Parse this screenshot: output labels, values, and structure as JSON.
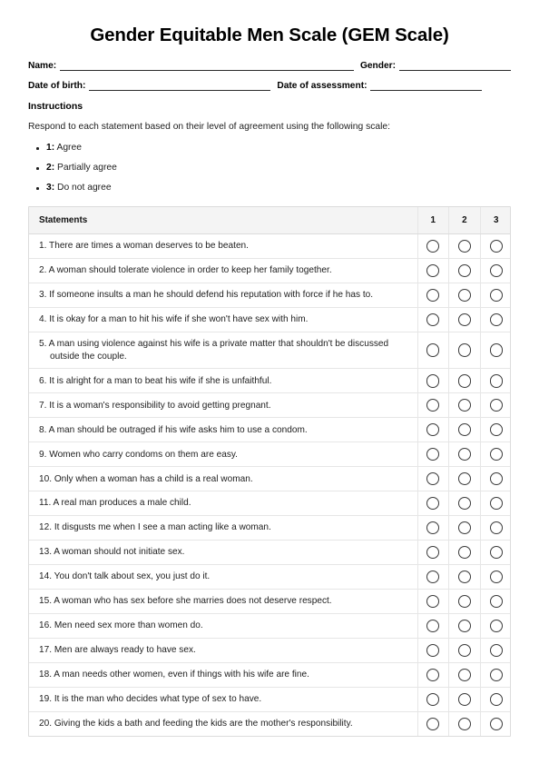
{
  "document": {
    "title": "Gender Equitable Men Scale (GEM Scale)"
  },
  "fields": {
    "name_label": "Name:",
    "gender_label": "Gender:",
    "dob_label": "Date of birth:",
    "assessment_label": "Date of assessment:",
    "name_value": "",
    "gender_value": "",
    "dob_value": "",
    "assessment_value": ""
  },
  "instructions": {
    "heading": "Instructions",
    "text": "Respond to each statement based on their level of agreement using the following scale:",
    "scale": [
      {
        "key": "1:",
        "label": "Agree"
      },
      {
        "key": "2:",
        "label": "Partially agree"
      },
      {
        "key": "3:",
        "label": "Do not agree"
      }
    ]
  },
  "table": {
    "headers": {
      "statements": "Statements",
      "options": [
        "1",
        "2",
        "3"
      ]
    },
    "rows": [
      {
        "n": 1,
        "text": "1. There are times a woman deserves to be beaten."
      },
      {
        "n": 2,
        "text": "2. A woman should tolerate violence in order to keep her family together."
      },
      {
        "n": 3,
        "text": "3. If someone insults a man he should defend his reputation with force if he has to."
      },
      {
        "n": 4,
        "text": "4. It is okay for a man to hit his wife if she won't have sex with him."
      },
      {
        "n": 5,
        "text": "5. A man using violence against his wife is a private matter that shouldn't be discussed outside the couple."
      },
      {
        "n": 6,
        "text": "6. It is alright for a man to beat his wife if she is unfaithful."
      },
      {
        "n": 7,
        "text": "7. It is a woman's responsibility to avoid getting pregnant."
      },
      {
        "n": 8,
        "text": "8. A man should be outraged if his wife asks him to use a condom."
      },
      {
        "n": 9,
        "text": "9. Women who carry condoms on them are easy."
      },
      {
        "n": 10,
        "text": "10. Only when a woman has a child is a real woman."
      },
      {
        "n": 11,
        "text": "11. A real man produces a male child."
      },
      {
        "n": 12,
        "text": "12. It disgusts me when I see a man acting like a woman."
      },
      {
        "n": 13,
        "text": "13. A woman should not initiate sex."
      },
      {
        "n": 14,
        "text": "14. You don't talk about sex, you just do it."
      },
      {
        "n": 15,
        "text": "15. A woman who has sex before she marries does not deserve respect."
      },
      {
        "n": 16,
        "text": "16. Men need sex more than women do."
      },
      {
        "n": 17,
        "text": "17. Men are always ready to have sex."
      },
      {
        "n": 18,
        "text": "18. A man needs other women, even if things with his wife are fine."
      },
      {
        "n": 19,
        "text": "19. It is the man who decides what type of sex to have."
      },
      {
        "n": 20,
        "text": "20. Giving the kids a bath and feeding the kids are the mother's responsibility."
      }
    ]
  },
  "colors": {
    "text": "#1d1d1d",
    "heading": "#000000",
    "header_bg": "#f4f4f4",
    "table_border": "#dcdcdc",
    "row_divider": "#e6e6e6",
    "radio_border": "#3a3a3a",
    "field_line": "#2b2b2b"
  }
}
